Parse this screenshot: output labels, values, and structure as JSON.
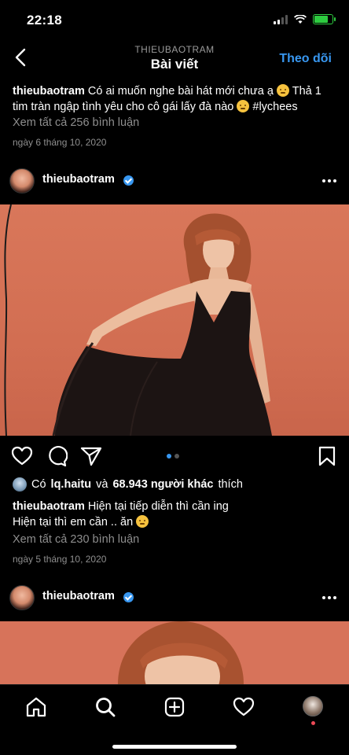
{
  "status_bar": {
    "time": "22:18"
  },
  "nav": {
    "subtitle": "THIEUBAOTRAM",
    "title": "Bài viết",
    "follow_label": "Theo dõi"
  },
  "top_post": {
    "username": "thieubaotram",
    "caption_part1": "Có ai muốn nghe bài hát mới chưa ạ",
    "caption_part2": "Thả 1 tim tràn ngập tình yêu cho cô gái lấy đà nào",
    "hashtag": "#lychees",
    "view_comments": "Xem tất cả 256 bình luận",
    "date": "ngày 6 tháng 10, 2020"
  },
  "post": {
    "username": "thieubaotram",
    "likes_prefix": "Có",
    "liked_by": "lq.haitu",
    "likes_middle": "và",
    "likes_count": "68.943 người khác",
    "likes_suffix": "thích",
    "caption_line1": "Hiện tại tiếp diễn thì cần ing",
    "caption_line2": "Hiện tại thì em cần .. ăn",
    "view_comments": "Xem tất cả 230 bình luận",
    "date": "ngày 5 tháng 10, 2020",
    "carousel_index": 1,
    "carousel_total": 2
  },
  "next_post": {
    "username": "thieubaotram"
  },
  "colors": {
    "accent": "#3897f0",
    "background": "#000000",
    "muted": "#8e8e8e",
    "photo_backdrop": "#d7735a"
  },
  "icons": [
    "back-chevron-icon",
    "more-icon",
    "heart-icon",
    "comment-icon",
    "share-icon",
    "bookmark-icon",
    "verified-icon",
    "home-icon",
    "search-icon",
    "add-icon",
    "activity-icon",
    "profile-icon"
  ]
}
